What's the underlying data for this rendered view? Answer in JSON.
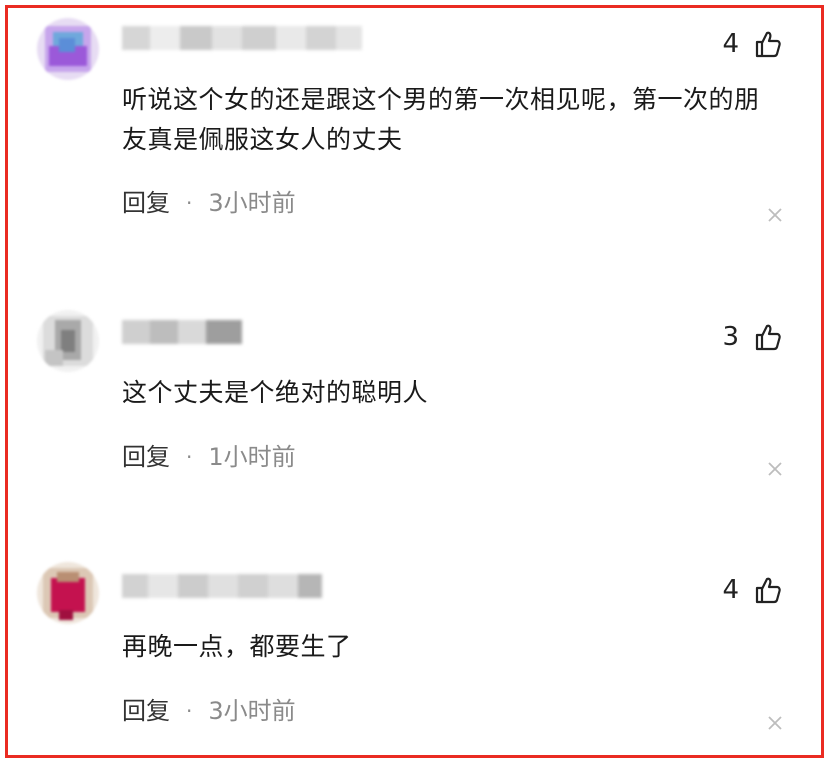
{
  "comments": [
    {
      "likes": "4",
      "text": "听说这个女的还是跟这个男的第一次相见呢，第一次的朋友真是佩服这女人的丈夫",
      "reply_label": "回复",
      "separator": "·",
      "time": "3小时前"
    },
    {
      "likes": "3",
      "text": "这个丈夫是个绝对的聪明人",
      "reply_label": "回复",
      "separator": "·",
      "time": "1小时前"
    },
    {
      "likes": "4",
      "text": "再晚一点，都要生了",
      "reply_label": "回复",
      "separator": "·",
      "time": "3小时前"
    }
  ],
  "colors": {
    "frame_border": "#ea2b22",
    "text": "#1a1a1a",
    "muted": "#8a8a8a"
  },
  "icons": {
    "like": "thumbs-up-icon",
    "dismiss": "close-icon"
  }
}
